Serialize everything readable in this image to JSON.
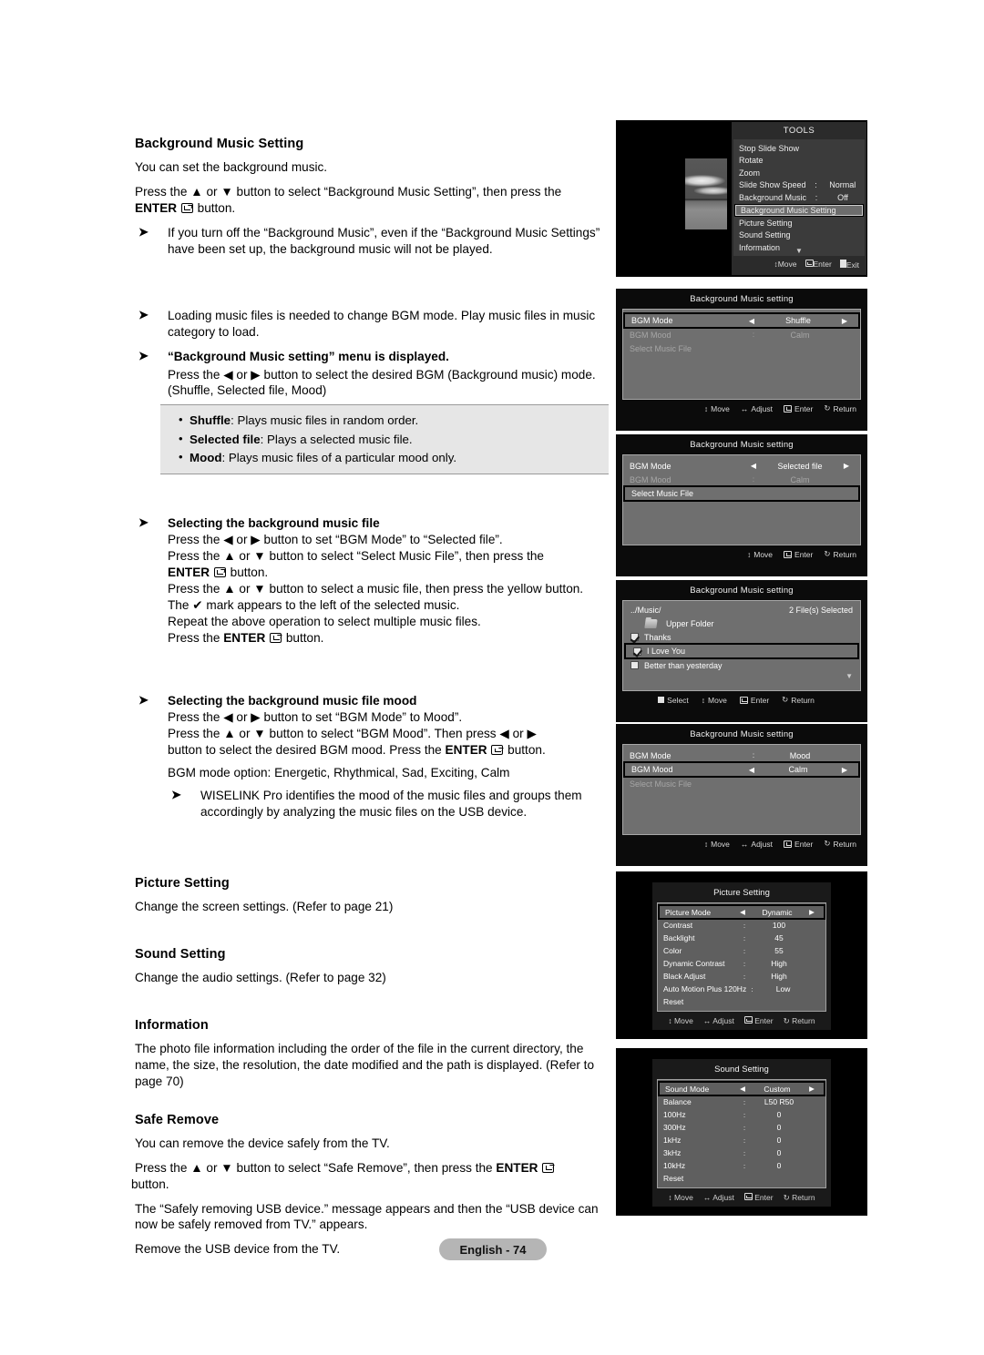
{
  "document": {
    "page_badge": "English - 74"
  },
  "left": {
    "s1": {
      "heading": "Background Music Setting",
      "p1": "You can set the background music.",
      "p2a": "Press the ",
      "p2b": " or ",
      "p2c": " button to select “Background Music Setting”, then press the ",
      "enter_word": "ENTER",
      "p2d": " button.",
      "note": "If you turn off the “Background Music”, even if the “Background Music Settings” have been set up, the background music will not be played."
    },
    "s2": {
      "note1": "Loading music files is needed to change BGM mode. Play music files in music category to load.",
      "note2_bold": "“Background Music setting” menu is displayed.",
      "note2_body": "Press the ◀ or ▶ button to select the desired BGM (Background music) mode. (Shuffle, Selected file, Mood)"
    },
    "callout": [
      {
        "term": "Shuffle",
        "desc": ": Plays music files in random order."
      },
      {
        "term": "Selected file",
        "desc": ": Plays a selected music file."
      },
      {
        "term": "Mood",
        "desc": ": Plays music files of a particular mood only."
      }
    ],
    "s3": {
      "heading": "Selecting the background music file",
      "l1": "Press the ◀ or ▶ button to set “BGM Mode” to “Selected file”.",
      "l2": "Press the ▲ or ▼ button to select “Select Music File”, then press the",
      "l3_pre": "",
      "l3_post": " button.",
      "l4": "Press the ▲ or ▼ button to select a music file, then press the yellow button.",
      "l5": "The ✔ mark appears to the left of the selected music.",
      "l6": "Repeat the above operation to select multiple music files.",
      "l7_pre": "Press the ",
      "l7_post": " button."
    },
    "s4": {
      "heading": "Selecting the background music file mood",
      "l1": "Press the ◀ or ▶ button to set “BGM Mode” to Mood”.",
      "l2": "Press the ▲ or ▼ button to select “BGM Mood”. Then press ◀ or ▶",
      "l3_pre": "button to select the desired BGM mood. Press the ",
      "l3_post": " button.",
      "l4": "BGM mode option: Energetic, Rhythmical, Sad, Exciting, Calm",
      "note": "WISELINK Pro identifies the mood of the music files and groups them accordingly by analyzing the music files on the USB device."
    },
    "s5": {
      "heading": "Picture Setting",
      "body": "Change the screen settings. (Refer to page 21)"
    },
    "s6": {
      "heading": "Sound Setting",
      "body": "Change the audio settings. (Refer to page 32)"
    },
    "s7": {
      "heading": "Information",
      "body": "The photo file information including the order of the file in the current directory, the name, the size, the resolution, the date modified and the path is displayed. (Refer to page 70)"
    },
    "s8": {
      "heading": "Safe Remove",
      "p1": "You can remove the device safely from the TV.",
      "p2_pre": "Press the ▲ or ▼ button to select “Safe Remove”, then press the ",
      "p2_bold": "ENTER",
      "p2_post": " button.",
      "p3": "The “Safely removing USB device.” message appears and then the “USB device can now be safely removed from TV.” appears.",
      "p4": "Remove the USB device from the TV."
    }
  },
  "osd": {
    "tools": {
      "title": "TOOLS",
      "items": [
        {
          "label": "Stop Slide Show",
          "colon": "",
          "value": "",
          "selected": false
        },
        {
          "label": "Rotate",
          "colon": "",
          "value": "",
          "selected": false
        },
        {
          "label": "Zoom",
          "colon": "",
          "value": "",
          "selected": false
        },
        {
          "label": "Slide Show Speed",
          "colon": ":",
          "value": "Normal",
          "selected": false
        },
        {
          "label": "Background Music",
          "colon": ":",
          "value": "Off",
          "selected": false
        },
        {
          "label": "Background Music Setting",
          "colon": "",
          "value": "",
          "selected": true
        },
        {
          "label": "Picture Setting",
          "colon": "",
          "value": "",
          "selected": false
        },
        {
          "label": "Sound Setting",
          "colon": "",
          "value": "",
          "selected": false
        },
        {
          "label": "Information",
          "colon": "",
          "value": "",
          "selected": false
        }
      ],
      "footer": {
        "move": "Move",
        "enter": "Enter",
        "exit": "Exit"
      }
    },
    "bgm_shuffle": {
      "title": "Background Music setting",
      "rows": [
        {
          "label": "BGM Mode",
          "value": "Shuffle",
          "mode": "adjust",
          "highlight": true,
          "dim": false
        },
        {
          "label": "BGM Mood",
          "value": "Calm",
          "mode": "static",
          "highlight": false,
          "dim": true
        },
        {
          "label": "Select Music File",
          "value": "",
          "mode": "plain",
          "highlight": false,
          "dim": true
        }
      ],
      "footer": {
        "move": "Move",
        "adjust": "Adjust",
        "enter": "Enter",
        "return": "Return"
      }
    },
    "bgm_selected": {
      "title": "Background Music setting",
      "rows": [
        {
          "label": "BGM Mode",
          "value": "Selected file",
          "mode": "adjust",
          "highlight": false,
          "dim": false
        },
        {
          "label": "BGM Mood",
          "value": "Calm",
          "mode": "static",
          "highlight": false,
          "dim": true
        },
        {
          "label": "Select Music File",
          "value": "",
          "mode": "plain",
          "highlight": true,
          "dim": false
        }
      ],
      "footer": {
        "move": "Move",
        "enter": "Enter",
        "return": "Return"
      }
    },
    "bgm_files": {
      "title": "Background Music setting",
      "path": "../Music/",
      "count": "2 File(s) Selected",
      "upper_folder": "Upper Folder",
      "files": [
        {
          "name": "Thanks",
          "checked": true,
          "highlight": false
        },
        {
          "name": "I Love You",
          "checked": true,
          "highlight": true
        },
        {
          "name": "Better than yesterday",
          "checked": false,
          "highlight": false
        }
      ],
      "footer": {
        "select": "Select",
        "move": "Move",
        "enter": "Enter",
        "return": "Return"
      }
    },
    "bgm_mood": {
      "title": "Background Music setting",
      "rows": [
        {
          "label": "BGM Mode",
          "value": "Mood",
          "mode": "static",
          "highlight": false,
          "dim": false
        },
        {
          "label": "BGM Mood",
          "value": "Calm",
          "mode": "adjust",
          "highlight": true,
          "dim": false
        },
        {
          "label": "Select Music File",
          "value": "",
          "mode": "plain",
          "highlight": false,
          "dim": true
        }
      ],
      "footer": {
        "move": "Move",
        "adjust": "Adjust",
        "enter": "Enter",
        "return": "Return"
      }
    },
    "picture_setting": {
      "title": "Picture Setting",
      "rows": [
        {
          "label": "Picture Mode",
          "value": "Dynamic",
          "mode": "adjust",
          "highlight": true
        },
        {
          "label": "Contrast",
          "value": "100",
          "mode": "static",
          "highlight": false
        },
        {
          "label": "Backlight",
          "value": "45",
          "mode": "static",
          "highlight": false
        },
        {
          "label": "Color",
          "value": "55",
          "mode": "static",
          "highlight": false
        },
        {
          "label": "Dynamic Contrast",
          "value": "High",
          "mode": "static",
          "highlight": false
        },
        {
          "label": "Black Adjust",
          "value": "High",
          "mode": "static",
          "highlight": false
        },
        {
          "label": "Auto Motion Plus 120Hz",
          "value": "Low",
          "mode": "static",
          "highlight": false
        },
        {
          "label": "Reset",
          "value": "",
          "mode": "plain",
          "highlight": false
        }
      ],
      "footer": {
        "move": "Move",
        "adjust": "Adjust",
        "enter": "Enter",
        "return": "Return"
      }
    },
    "sound_setting": {
      "title": "Sound Setting",
      "rows": [
        {
          "label": "Sound Mode",
          "value": "Custom",
          "mode": "adjust",
          "highlight": true
        },
        {
          "label": "Balance",
          "value": "L50  R50",
          "mode": "static",
          "highlight": false
        },
        {
          "label": "100Hz",
          "value": "0",
          "mode": "static",
          "highlight": false
        },
        {
          "label": "300Hz",
          "value": "0",
          "mode": "static",
          "highlight": false
        },
        {
          "label": "1kHz",
          "value": "0",
          "mode": "static",
          "highlight": false
        },
        {
          "label": "3kHz",
          "value": "0",
          "mode": "static",
          "highlight": false
        },
        {
          "label": "10kHz",
          "value": "0",
          "mode": "static",
          "highlight": false
        },
        {
          "label": "Reset",
          "value": "",
          "mode": "plain",
          "highlight": false
        }
      ],
      "footer": {
        "move": "Move",
        "adjust": "Adjust",
        "enter": "Enter",
        "return": "Return"
      }
    }
  }
}
